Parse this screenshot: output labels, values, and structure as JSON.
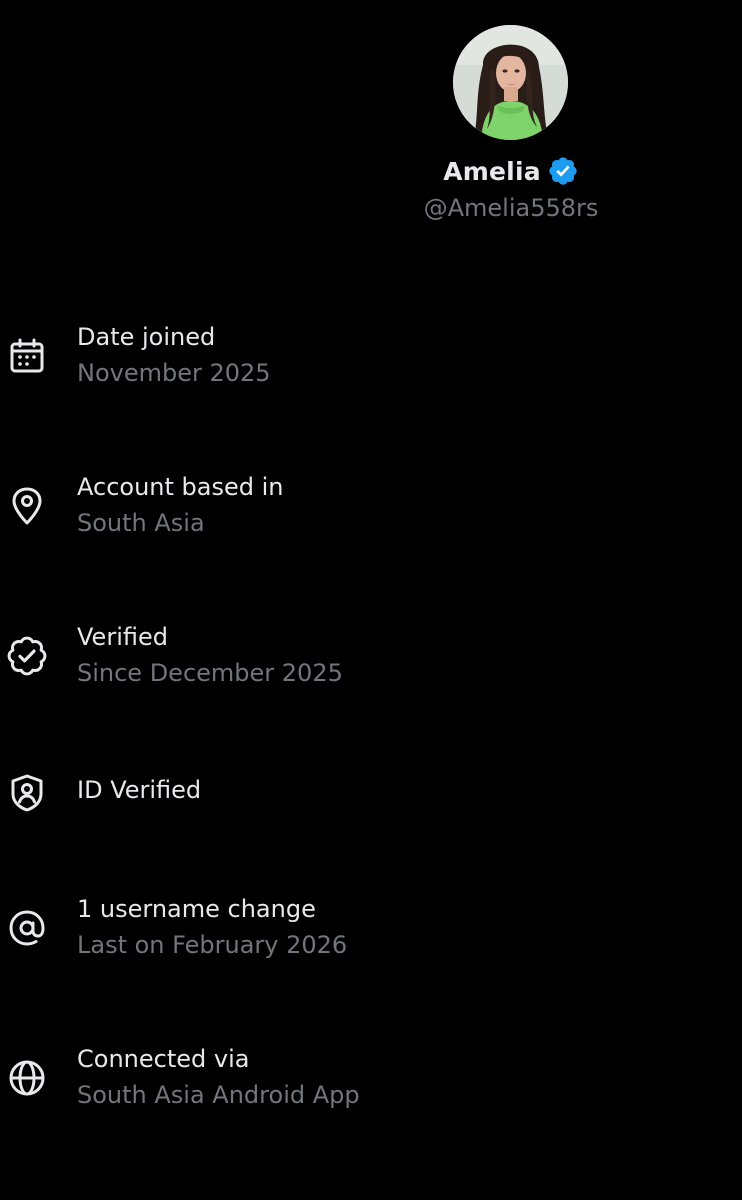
{
  "profile": {
    "display_name": "Amelia",
    "handle": "@Amelia558rs",
    "verified_badge_color": "#1d9bf0"
  },
  "details": [
    {
      "icon": "calendar-icon",
      "title": "Date joined",
      "subtitle": "November 2025"
    },
    {
      "icon": "location-pin-icon",
      "title": "Account based in",
      "subtitle": "South Asia"
    },
    {
      "icon": "verified-check-icon",
      "title": "Verified",
      "subtitle": "Since December 2025"
    },
    {
      "icon": "id-shield-icon",
      "title": "ID Verified",
      "subtitle": ""
    },
    {
      "icon": "at-sign-icon",
      "title": "1 username change",
      "subtitle": "Last on February 2026"
    },
    {
      "icon": "globe-icon",
      "title": "Connected via",
      "subtitle": "South Asia Android App"
    }
  ],
  "colors": {
    "background": "#000000",
    "primary_text": "#e7e9ea",
    "secondary_text": "#71767b",
    "accent": "#1d9bf0"
  }
}
